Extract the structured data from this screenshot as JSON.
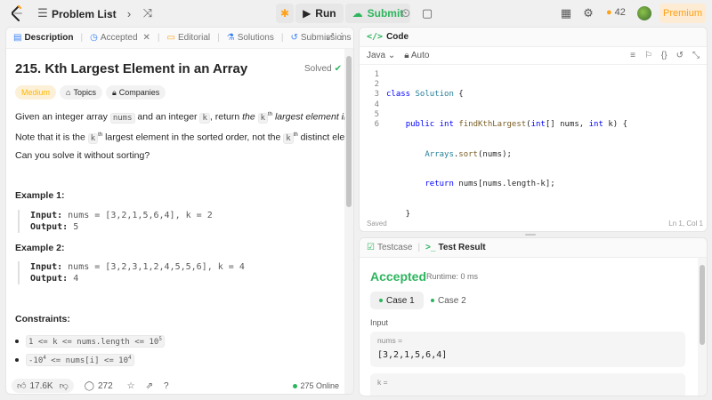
{
  "topbar": {
    "problem_list": "Problem List",
    "run": "Run",
    "submit": "Submit",
    "streak_count": "42",
    "premium": "Premium"
  },
  "description": {
    "tabs": [
      {
        "label": "Description"
      },
      {
        "label": "Accepted"
      },
      {
        "label": "Editorial"
      },
      {
        "label": "Solutions"
      },
      {
        "label": "Submissions"
      }
    ],
    "title": "215. Kth Largest Element in an Array",
    "status": "Solved",
    "difficulty": "Medium",
    "tag_topics": "Topics",
    "tag_companies": "Companies",
    "p1_a": "Given an integer array ",
    "p1_code1": "nums",
    "p1_b": " and an integer ",
    "p1_code2": "k",
    "p1_c": ", return ",
    "p1_d": "the ",
    "p1_code3": "k",
    "p1_sup": "th",
    "p1_e": " largest element in the array",
    "p1_f": ".",
    "p2_a": "Note that it is the ",
    "p2_code": "k",
    "p2_sup": "th",
    "p2_b": " largest element in the sorted order, not the ",
    "p2_code2": "k",
    "p2_sup2": "th",
    "p2_c": " distinct element.",
    "p3": "Can you solve it without sorting?",
    "example1_title": "Example 1:",
    "example1_input_label": "Input:",
    "example1_input": "nums = [3,2,1,5,6,4], k = 2",
    "example1_output_label": "Output:",
    "example1_output": "5",
    "example2_title": "Example 2:",
    "example2_input_label": "Input:",
    "example2_input": "nums = [3,2,3,1,2,4,5,5,6], k = 4",
    "example2_output_label": "Output:",
    "example2_output": "4",
    "constraints_title": "Constraints:",
    "c1_a": "1 <= k <= nums.length <= 10",
    "c1_sup": "5",
    "c2_a": "-10",
    "c2_sup": "4",
    "c2_b": " <= nums[i] <= 10",
    "c2_sup2": "4",
    "likes": "17.6K",
    "comments": "272",
    "online": "275 Online"
  },
  "code": {
    "header": "Code",
    "language": "Java",
    "mode": "Auto",
    "line_numbers": [
      "1",
      "2",
      "3",
      "4",
      "5",
      "6"
    ],
    "status_saved": "Saved",
    "cursor": "Ln 1, Col 1"
  },
  "result": {
    "tab_testcase": "Testcase",
    "tab_result": "Test Result",
    "verdict": "Accepted",
    "runtime": "Runtime: 0 ms",
    "case1": "Case 1",
    "case2": "Case 2",
    "input_label": "Input",
    "nums_label": "nums =",
    "nums_value": "[3,2,1,5,6,4]",
    "k_label": "k ="
  },
  "colors": {
    "accent_green": "#2db55d",
    "medium": "#ffb800",
    "premium": "#ffa116"
  }
}
